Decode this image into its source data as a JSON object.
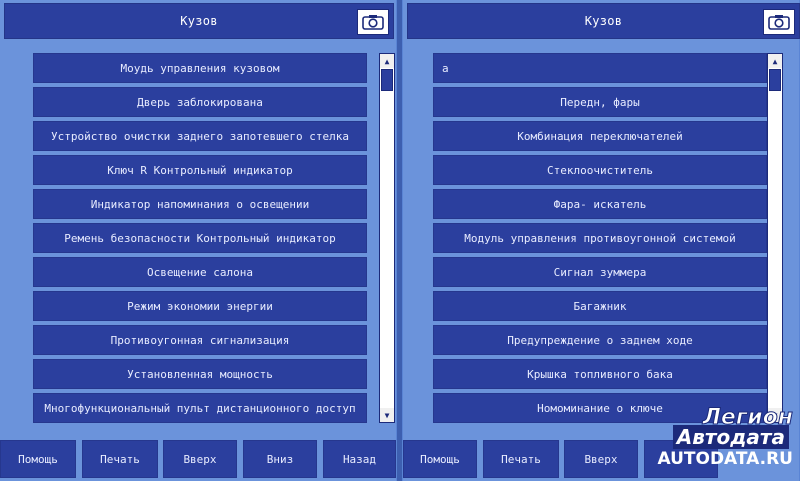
{
  "left": {
    "title": "Кузов",
    "items": [
      "Моудь управления кузовом",
      "Дверь заблокирована",
      "Устройство очистки заднего запотевшего стелка",
      "Ключ R Контрольный индикатор",
      "Индикатор напоминания о освещении",
      "Ремень безопасности Контрольный индикатор",
      "Освещение салона",
      "Режим экономии энергии",
      "Противоугонная сигнализация",
      "Установленная мощность",
      "Многофункциональный пульт дистанционного доступ"
    ],
    "toolbar": {
      "help": "Помощь",
      "print": "Печать",
      "up": "Вверх",
      "down": "Вниз",
      "back": "Назад"
    }
  },
  "right": {
    "title": "Кузов",
    "items": [
      "а",
      "Передн, фары",
      "Комбинация переключателей",
      "Стеклоочиститель",
      "Фара- искатель",
      "Модуль управления противоугонной системой",
      "Сигнал зуммера",
      "Багажник",
      "Предупреждение о заднем ходе",
      "Крышка топливного бака",
      "Номоминание о ключе"
    ],
    "toolbar": {
      "help": "Помощь",
      "print": "Печать",
      "up": "Вверх"
    }
  },
  "watermark": {
    "line1": "Легион",
    "line2": "Автодата",
    "line3": "AUTODATA.RU"
  },
  "icons": {
    "camera": "camera-icon",
    "scroll_up": "triangle-up-icon",
    "scroll_down": "triangle-down-icon"
  },
  "colors": {
    "background": "#5a84d4",
    "panel": "#6b93db",
    "button": "#2b3f9e",
    "text": "#e8ecff"
  }
}
